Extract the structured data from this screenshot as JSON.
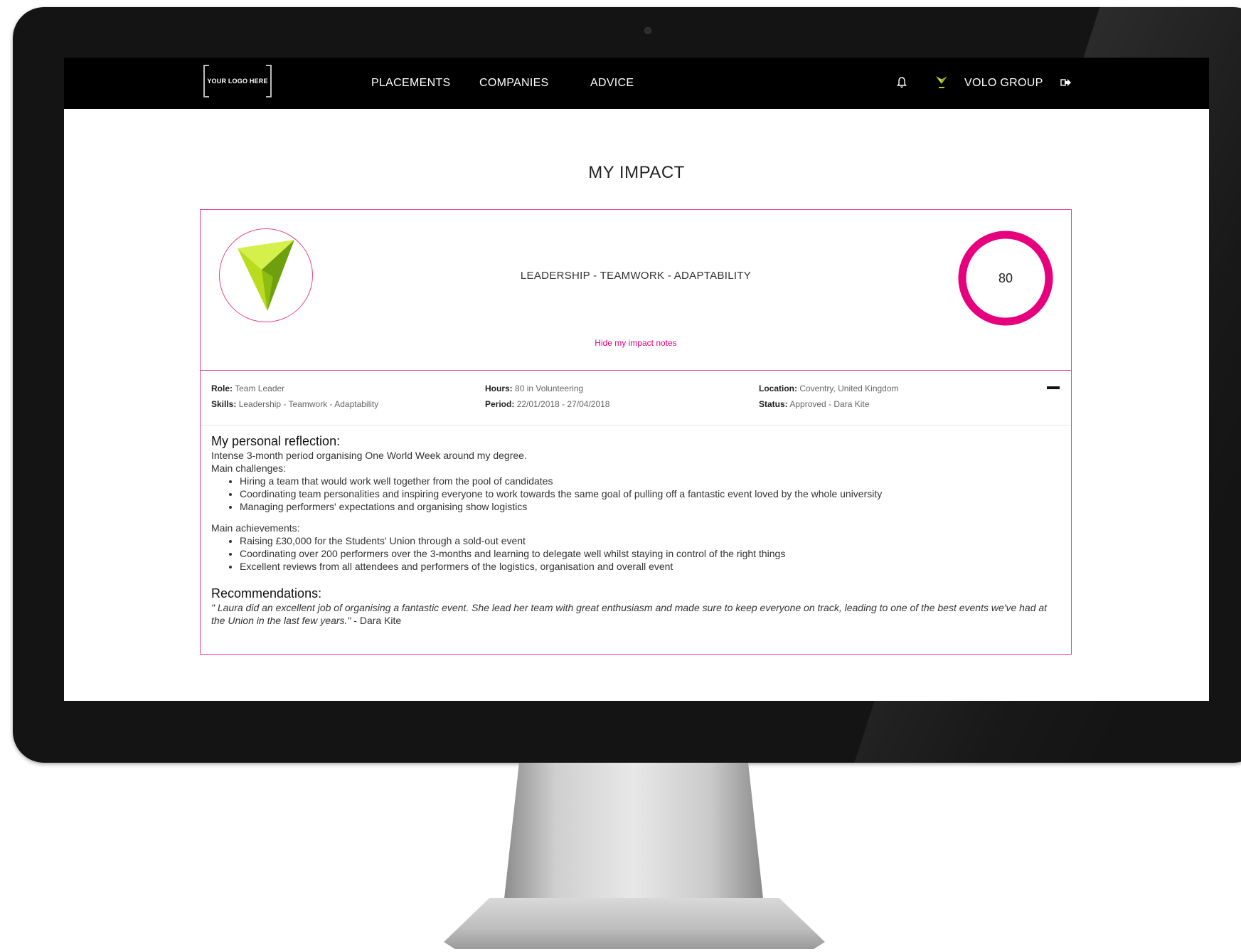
{
  "nav": {
    "logo_text": "YOUR LOGO HERE",
    "links": [
      "PLACEMENTS",
      "COMPANIES",
      "ADVICE"
    ],
    "org_name": "VOLO GROUP",
    "icons": [
      "bell-icon",
      "volo-logo-icon",
      "logout-icon"
    ]
  },
  "page": {
    "title": "MY IMPACT"
  },
  "impact": {
    "skills_heading": "LEADERSHIP - TEAMWORK - ADAPTABILITY",
    "score": "80",
    "hide_link": "Hide my impact notes",
    "accent_color": "#e6007e",
    "meta": {
      "role_label": "Role:",
      "role_value": "Team Leader",
      "skills_label": "Skills:",
      "skills_value": "Leadership - Teamwork - Adaptability",
      "hours_label": "Hours:",
      "hours_value": "80 in Volunteering",
      "period_label": "Period:",
      "period_value": "22/01/2018 - 27/04/2018",
      "location_label": "Location:",
      "location_value": "Coventry, United Kingdom",
      "status_label": "Status:",
      "status_value": "Approved  - Dara Kite"
    },
    "reflection": {
      "heading": "My personal reflection:",
      "intro": "Intense 3-month period organising One World Week around my degree.",
      "challenges_label": "Main challenges:",
      "challenges": [
        "Hiring a team that would work well together from the pool of candidates",
        "Coordinating team personalities and inspiring everyone to work towards the same goal of pulling off a fantastic event loved by the whole university",
        "Managing performers' expectations and organising show logistics"
      ],
      "achievements_label": "Main achievements:",
      "achievements": [
        "Raising £30,000 for the Students' Union through a sold-out event",
        "Coordinating over 200 performers over the 3-months and learning to delegate well whilst staying in control of the right things",
        "Excellent reviews from all attendees and performers of the logistics, organisation and overall event"
      ]
    },
    "recommendations": {
      "heading": "Recommendations:",
      "quote": "\" Laura did an excellent job of organising a fantastic event. She lead her team with great enthusiasm and made sure to keep everyone on track, leading to one of the best events we've had at the Union in the last few years.\"",
      "author": " - Dara Kite"
    }
  }
}
